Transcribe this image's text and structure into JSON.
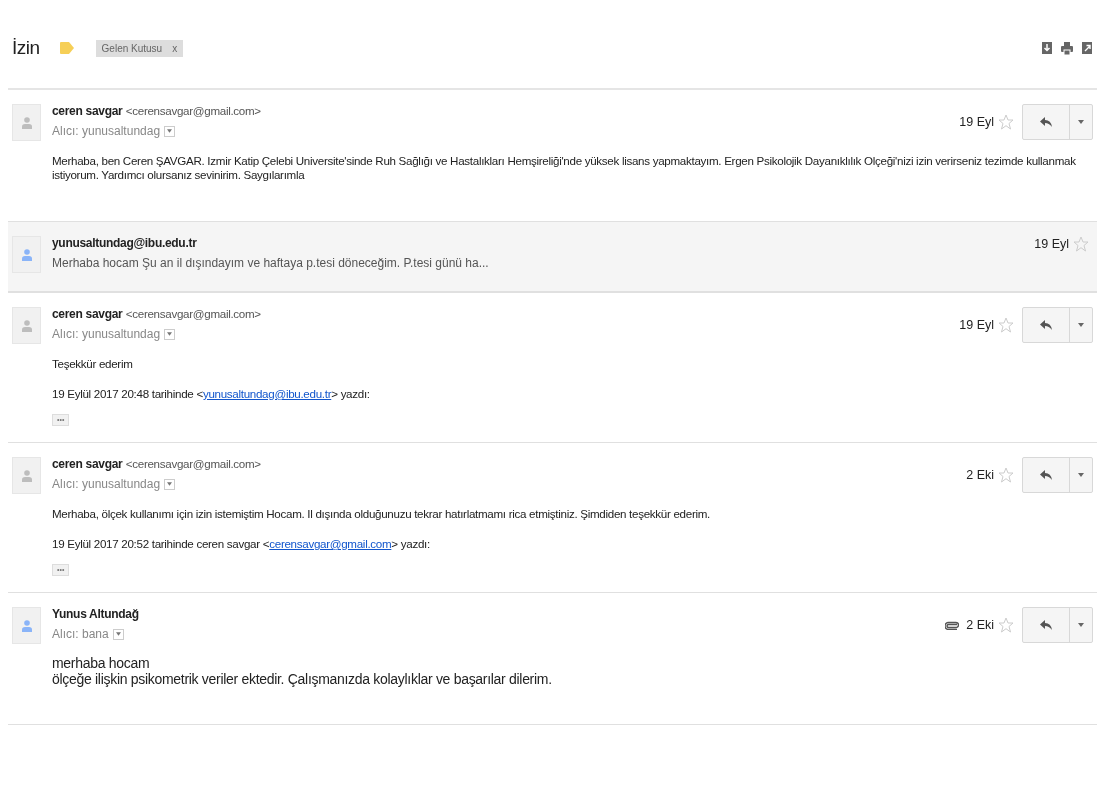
{
  "thread": {
    "title": "İzin",
    "labels": [
      {
        "text": "Gelen Kutusu",
        "remove": "x"
      }
    ]
  },
  "messages": [
    {
      "kind": "expanded",
      "sender": "ceren savgar",
      "email": "<cerensavgar@gmail.com>",
      "color": "#bdbdbd",
      "to": "Alıcı: yunusaltundag",
      "date": "19 Eyl",
      "starred": false,
      "attachment": false,
      "large_text": false,
      "body": [
        "Merhaba, ben Ceren ŞAVGAR. Izmir Katip Çelebi Universite'sinde Ruh Sağlığı ve Hastalıkları Hemşireliği'nde yüksek lisans yapmaktayım. Ergen Psikolojik Dayanıklılık Olçeği'nizi izin verirseniz tezimde kullanmak istiyorum. Yardımcı olursanız sevinirim. Saygılarımla"
      ]
    },
    {
      "kind": "collapsed",
      "sender": "yunusaltundag@ibu.edu.tr",
      "color": "#8ab4f8",
      "snippet": "Merhaba hocam Şu an il dışındayım ve haftaya p.tesi döneceğim. P.tesi günü ha...",
      "date": "19 Eyl",
      "starred": false
    },
    {
      "kind": "expanded",
      "sender": "ceren savgar",
      "email": "<cerensavgar@gmail.com>",
      "color": "#bdbdbd",
      "to": "Alıcı: yunusaltundag",
      "date": "19 Eyl",
      "starred": false,
      "attachment": false,
      "large_text": false,
      "body": [
        "Teşekkür ederim"
      ],
      "quote": {
        "prefix": "19 Eylül 2017 20:48 tarihinde <",
        "link": "yunusaltundag@ibu.edu.tr",
        "suffix": "> yazdı:"
      },
      "trimmed": "•••"
    },
    {
      "kind": "expanded",
      "sender": "ceren savgar",
      "email": "<cerensavgar@gmail.com>",
      "color": "#bdbdbd",
      "to": "Alıcı: yunusaltundag",
      "date": "2 Eki",
      "starred": false,
      "attachment": false,
      "large_text": false,
      "body": [
        "Merhaba, ölçek kullanımı için izin istemiştim Hocam. Il dışında olduğunuzu tekrar hatırlatmamı rica etmiştiniz. Şimdiden teşekkür ederim."
      ],
      "quote": {
        "prefix": "19 Eylül 2017 20:52 tarihinde ceren savgar <",
        "link": "cerensavgar@gmail.com",
        "suffix": "> yazdı:"
      },
      "trimmed": "•••"
    },
    {
      "kind": "expanded",
      "sender": "Yunus Altundağ",
      "color": "#8ab4f8",
      "to": "Alıcı: bana",
      "date": "2 Eki",
      "starred": false,
      "attachment": true,
      "large_text": true,
      "body": [
        "merhaba hocam\nölçeğe ilişkin psikometrik veriler ektedir. Çalışmanızda kolaylıklar ve başarılar dilerim."
      ]
    }
  ]
}
